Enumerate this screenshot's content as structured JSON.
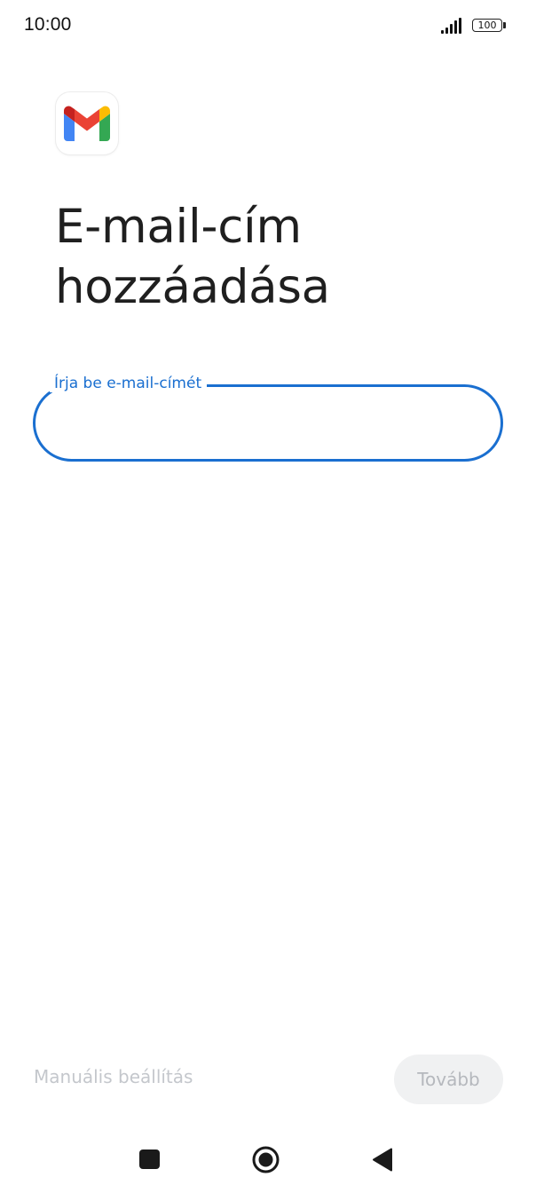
{
  "status_bar": {
    "time": "10:00",
    "battery_level": "100",
    "signal_icon": "signal-bars-icon"
  },
  "app": {
    "logo_icon": "gmail-logo-icon"
  },
  "page": {
    "title": "E-mail-cím hozzáadása"
  },
  "email_field": {
    "label": "Írja be e-mail-címét",
    "value": "",
    "accent_color": "#1a6fd0"
  },
  "actions": {
    "manual_setup_label": "Manuális beállítás",
    "next_label": "Tovább"
  },
  "nav_bar": {
    "recents_icon": "square-recents-icon",
    "home_icon": "circle-home-icon",
    "back_icon": "triangle-back-icon"
  }
}
